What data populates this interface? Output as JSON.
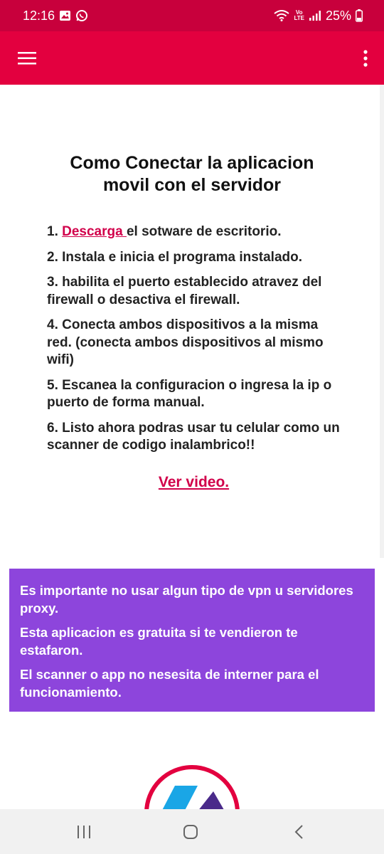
{
  "status_bar": {
    "time": "12:16",
    "battery": "25%",
    "icons": [
      "gallery-icon",
      "whatsapp-icon",
      "wifi-icon",
      "volte-icon",
      "signal-icon",
      "battery-icon"
    ],
    "volte_label_top": "Vo",
    "volte_label_bottom": "LTE"
  },
  "app_bar": {
    "menu_icon": "hamburger-menu-icon",
    "more_icon": "more-vertical-icon",
    "color": "#e3003f"
  },
  "content": {
    "title_line1": "Como Conectar la aplicacion",
    "title_line2": "movil con el servidor",
    "step1_prefix": "1. ",
    "step1_link": "Descarga ",
    "step1_rest": "el sotware de escritorio.",
    "steps": [
      "2. Instala e inicia el programa instalado.",
      "3. habilita el puerto establecido atravez del firewall o desactiva el firewall.",
      "4. Conecta ambos dispositivos a la misma red. (conecta ambos dispositivos al mismo wifi)",
      "5. Escanea la configuracion o ingresa la ip o puerto de forma manual.",
      "6. Listo ahora podras usar tu celular como un scanner de codigo inalambrico!!"
    ],
    "video_link": "Ver video. ",
    "link_color": "#d1004a"
  },
  "notice": {
    "background": "#8d45dc",
    "lines": [
      "Es importante no usar algun tipo de vpn u servidores proxy.",
      "Esta aplicacion es gratuita si te vendieron te estafaron.",
      "El scanner o app no nesesita de interner para el funcionamiento."
    ]
  },
  "navigation": {
    "recents_icon": "recents-icon",
    "home_icon": "home-icon",
    "back_icon": "back-icon"
  }
}
